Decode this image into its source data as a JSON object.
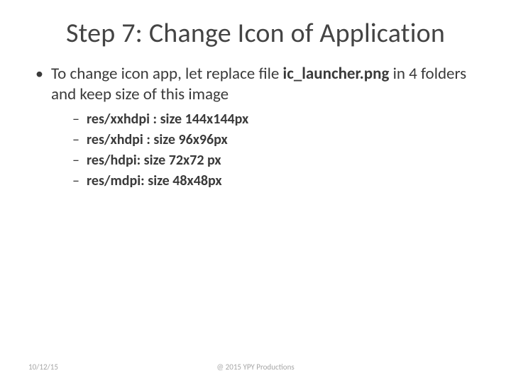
{
  "title": "Step 7: Change Icon of Application",
  "bullet": {
    "prefix": "To change icon app, let replace file ",
    "bold": "ic_launcher.png",
    "suffix": " in 4 folders and keep size of this image"
  },
  "sizes": [
    "res/xxhdpi : size 144x144px",
    "res/xhdpi : size 96x96px",
    "res/hdpi: size 72x72 px",
    "res/mdpi: size 48x48px"
  ],
  "footer": {
    "date": "10/12/15",
    "copyright": "@ 2015 YPY Productions"
  }
}
